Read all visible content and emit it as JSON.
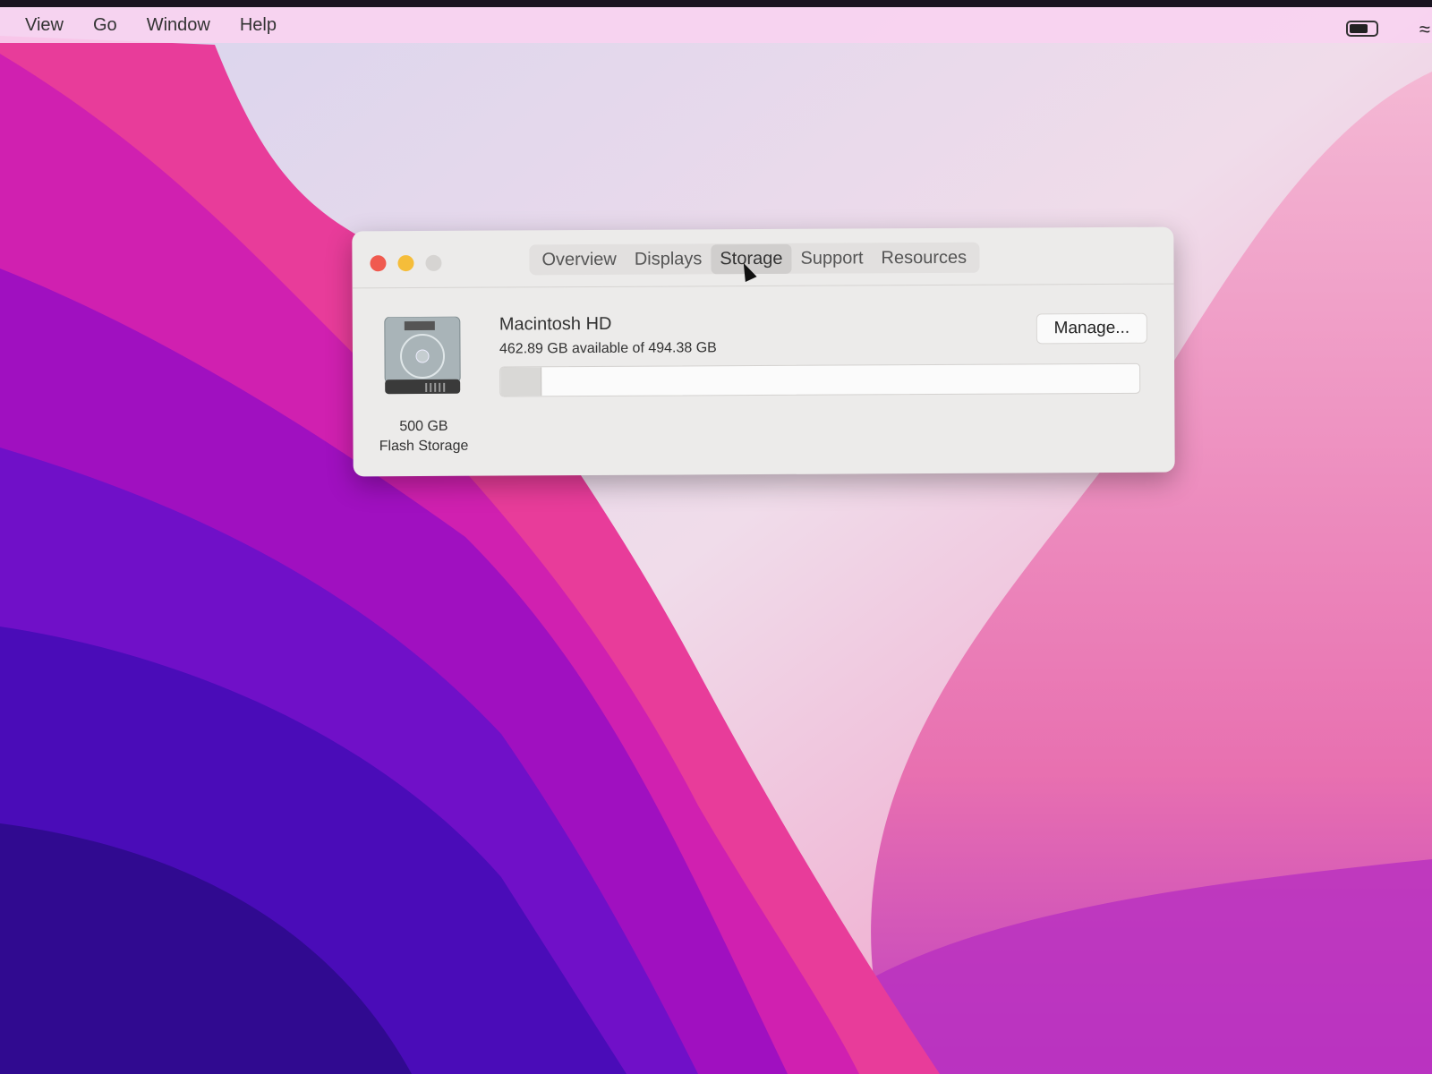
{
  "menubar": {
    "items": [
      "View",
      "Go",
      "Window",
      "Help"
    ]
  },
  "window": {
    "tabs": [
      "Overview",
      "Displays",
      "Storage",
      "Support",
      "Resources"
    ],
    "active_tab": "Storage",
    "disk": {
      "size": "500 GB",
      "type": "Flash Storage"
    },
    "volume": {
      "name": "Macintosh HD",
      "info": "462.89 GB available of 494.38 GB",
      "used_fraction": 0.064
    },
    "manage_label": "Manage..."
  },
  "colors": {
    "close": "#f05a4f",
    "minimize": "#f5bd3a",
    "zoom": "#d6d4d2"
  }
}
